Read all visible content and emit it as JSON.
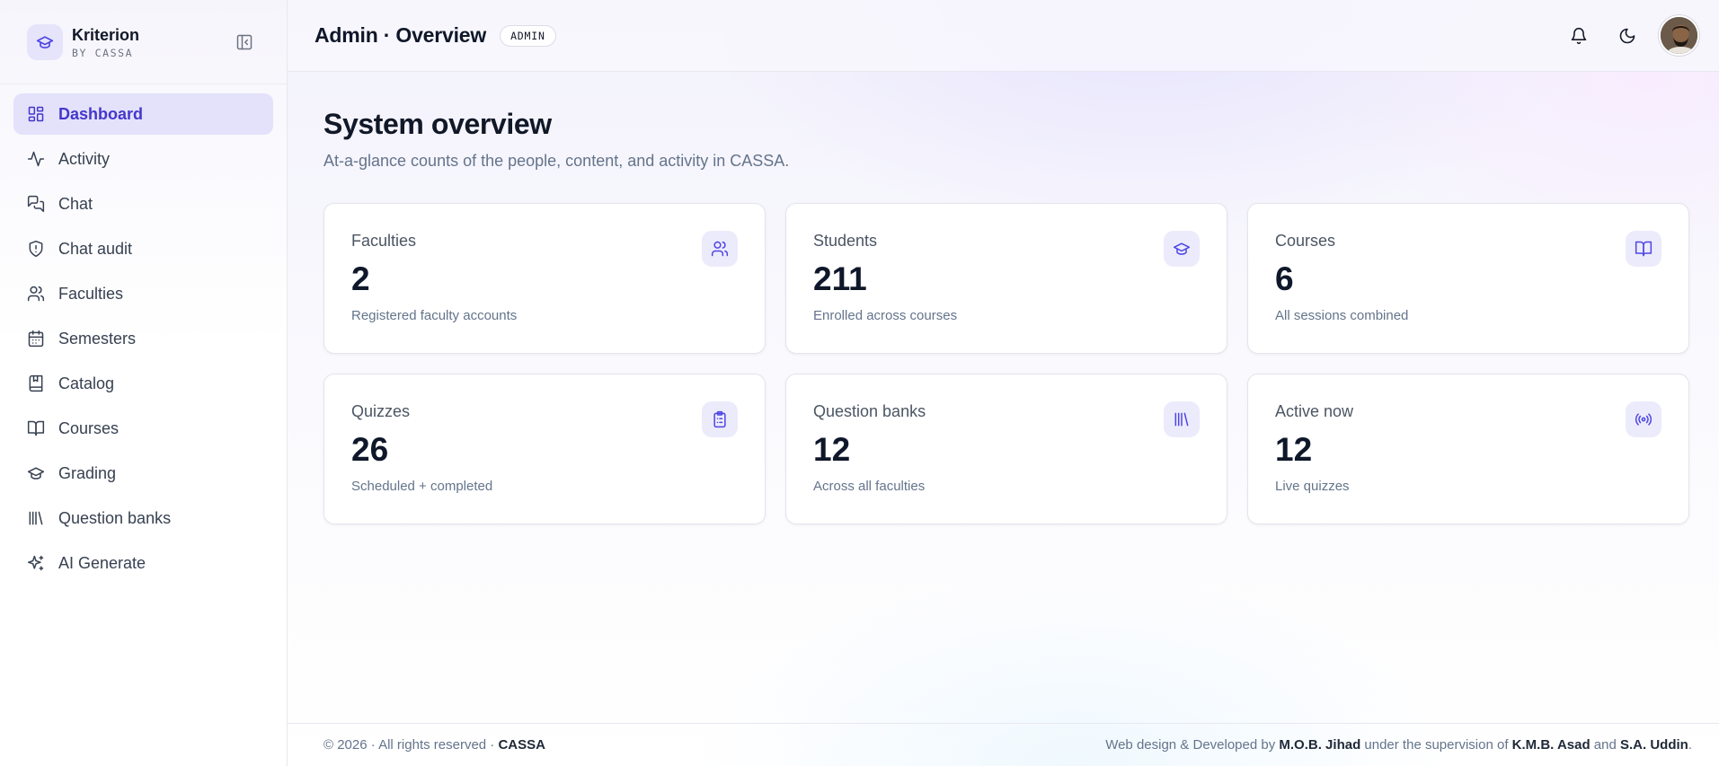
{
  "brand": {
    "name": "Kriterion",
    "sub": "BY CASSA"
  },
  "sidebar": {
    "items": [
      {
        "label": "Dashboard",
        "icon": "dashboard-icon",
        "active": true
      },
      {
        "label": "Activity",
        "icon": "activity-icon"
      },
      {
        "label": "Chat",
        "icon": "chat-icon"
      },
      {
        "label": "Chat audit",
        "icon": "shield-alert-icon"
      },
      {
        "label": "Faculties",
        "icon": "users-icon"
      },
      {
        "label": "Semesters",
        "icon": "calendar-icon"
      },
      {
        "label": "Catalog",
        "icon": "bookmark-book-icon"
      },
      {
        "label": "Courses",
        "icon": "book-open-icon"
      },
      {
        "label": "Grading",
        "icon": "graduation-cap-icon"
      },
      {
        "label": "Question banks",
        "icon": "library-icon"
      },
      {
        "label": "AI Generate",
        "icon": "sparkles-icon"
      }
    ]
  },
  "header": {
    "title": "Admin · Overview",
    "badge": "ADMIN"
  },
  "main": {
    "title": "System overview",
    "subtitle": "At-a-glance counts of the people, content, and activity in CASSA.",
    "cards": [
      {
        "label": "Faculties",
        "value": "2",
        "note": "Registered faculty accounts",
        "icon": "users-icon"
      },
      {
        "label": "Students",
        "value": "211",
        "note": "Enrolled across courses",
        "icon": "graduation-cap-icon"
      },
      {
        "label": "Courses",
        "value": "6",
        "note": "All sessions combined",
        "icon": "book-open-icon"
      },
      {
        "label": "Quizzes",
        "value": "26",
        "note": "Scheduled + completed",
        "icon": "clipboard-list-icon"
      },
      {
        "label": "Question banks",
        "value": "12",
        "note": "Across all faculties",
        "icon": "library-icon"
      },
      {
        "label": "Active now",
        "value": "12",
        "note": "Live quizzes",
        "icon": "radio-icon"
      }
    ]
  },
  "footer": {
    "copyright": "© 2026 · All rights reserved · ",
    "org": "CASSA",
    "credit_prefix": "Web design & Developed by ",
    "developer": "M.O.B. Jihad",
    "credit_mid": " under the supervision of ",
    "supervisor1": "K.M.B. Asad",
    "credit_and": " and ",
    "supervisor2": "S.A. Uddin",
    "credit_end": "."
  },
  "colors": {
    "accent": "#4338ca",
    "accent_soft": "#e4e1fb"
  }
}
